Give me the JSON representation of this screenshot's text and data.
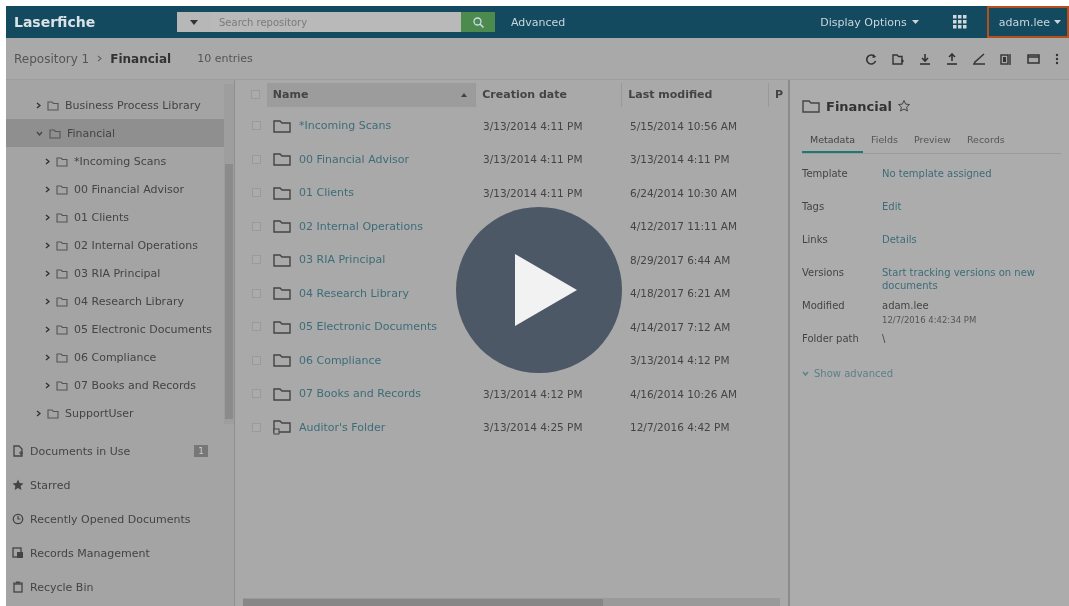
{
  "top_bar": {
    "logo": "Laserfiche",
    "search": {
      "placeholder": "Search repository"
    },
    "advanced": "Advanced",
    "display_options": "Display Options",
    "user": {
      "label": "adam.lee",
      "highlighted": true
    }
  },
  "breadcrumb": {
    "items": [
      "Repository 1",
      "Financial"
    ],
    "count": "10 entries"
  },
  "tree": [
    {
      "label": "Business Process Library",
      "expanded": false,
      "selected": false
    },
    {
      "label": "Financial",
      "expanded": true,
      "selected": true,
      "children": [
        {
          "label": "*Incoming Scans",
          "expanded": false,
          "selected": false
        },
        {
          "label": "00 Financial Advisor",
          "expanded": false,
          "selected": false
        },
        {
          "label": "01 Clients",
          "expanded": false,
          "selected": false
        },
        {
          "label": "02 Internal Operations",
          "expanded": false,
          "selected": false
        },
        {
          "label": "03 RIA Principal",
          "expanded": false,
          "selected": false
        },
        {
          "label": "04 Research Library",
          "expanded": false,
          "selected": false
        },
        {
          "label": "05 Electronic Documents",
          "expanded": false,
          "selected": false
        },
        {
          "label": "06 Compliance",
          "expanded": false,
          "selected": false
        },
        {
          "label": "07 Books and Records",
          "expanded": false,
          "selected": false
        }
      ]
    },
    {
      "label": "SupportUser",
      "expanded": false,
      "selected": false
    }
  ],
  "nav": [
    {
      "kind": "docs",
      "label": "Documents in Use",
      "badge": "1"
    },
    {
      "kind": "star",
      "label": "Starred"
    },
    {
      "kind": "clock",
      "label": "Recently Opened Documents"
    },
    {
      "kind": "records",
      "label": "Records Management"
    },
    {
      "kind": "bin",
      "label": "Recycle Bin"
    }
  ],
  "table": {
    "select_all_checked": false,
    "columns": [
      "Name",
      "Creation date",
      "Last modified",
      "P"
    ],
    "rows": [
      {
        "kind": "folder",
        "checked": false,
        "name": "*Incoming Scans",
        "created": "3/13/2014 4:11 PM",
        "modified": "5/15/2014 10:56 AM"
      },
      {
        "kind": "folder",
        "checked": false,
        "name": "00 Financial Advisor",
        "created": "3/13/2014 4:11 PM",
        "modified": "3/13/2014 4:11 PM"
      },
      {
        "kind": "folder",
        "checked": false,
        "name": "01 Clients",
        "created": "3/13/2014 4:11 PM",
        "modified": "6/24/2014 10:30 AM"
      },
      {
        "kind": "folder",
        "checked": false,
        "name": "02 Internal Operations",
        "modified": "4/12/2017 11:11 AM"
      },
      {
        "kind": "folder",
        "checked": false,
        "name": "03 RIA Principal",
        "modified": "8/29/2017 6:44 AM"
      },
      {
        "kind": "folder",
        "checked": false,
        "name": "04 Research Library",
        "modified": "4/18/2017 6:21 AM"
      },
      {
        "kind": "folder",
        "checked": false,
        "name": "05 Electronic Documents",
        "modified": "4/14/2017 7:12 AM"
      },
      {
        "kind": "folder",
        "checked": false,
        "name": "06 Compliance",
        "modified": "3/13/2014 4:12 PM"
      },
      {
        "kind": "folder",
        "checked": false,
        "name": "07 Books and Records",
        "created": "3/13/2014 4:12 PM",
        "modified": "4/16/2014 10:26 AM"
      },
      {
        "kind": "shortcut",
        "checked": false,
        "name": "Auditor's Folder",
        "created": "3/13/2014 4:25 PM",
        "modified": "12/7/2016 4:42 PM"
      }
    ]
  },
  "details": {
    "title": "Financial",
    "starred": false,
    "tabs": [
      {
        "label": "Metadata",
        "selected": true
      },
      {
        "label": "Fields",
        "selected": false
      },
      {
        "label": "Preview",
        "selected": false
      },
      {
        "label": "Records",
        "selected": false
      }
    ],
    "fields": [
      {
        "kind": "link",
        "label": "Template",
        "value": "No template assigned"
      },
      {
        "kind": "link",
        "label": "Tags",
        "value": "Edit"
      },
      {
        "kind": "link",
        "label": "Links",
        "value": "Details"
      },
      {
        "kind": "link",
        "label": "Versions",
        "value": "Start tracking versions on new documents"
      },
      {
        "kind": "text",
        "label": "Modified",
        "value": "adam.lee",
        "sub": "12/7/2016 4:42:34 PM"
      },
      {
        "kind": "text",
        "label": "Folder path",
        "value": "\\"
      }
    ],
    "show_advanced": "Show advanced"
  }
}
